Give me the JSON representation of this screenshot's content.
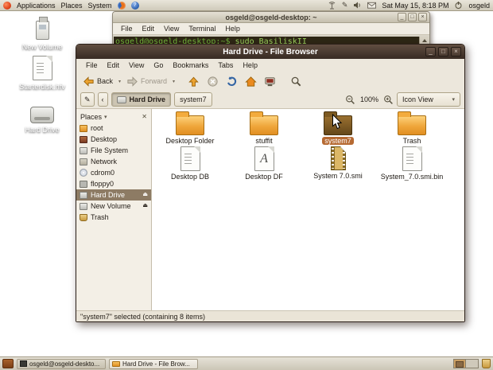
{
  "top_panel": {
    "menus": [
      "Applications",
      "Places",
      "System"
    ],
    "clock": "Sat May 15, 8:18 PM",
    "user": "osgeld"
  },
  "desktop_icons": [
    {
      "label": "New Volume"
    },
    {
      "label": "Starterdisk.hfv"
    },
    {
      "label": "Hard Drive"
    }
  ],
  "terminal": {
    "title": "osgeld@osgeld-desktop: ~",
    "menu": [
      "File",
      "Edit",
      "View",
      "Terminal",
      "Help"
    ],
    "prompt": "osgeld@osgeld-desktop:~$",
    "command": "sudo BasiliskII"
  },
  "file_browser": {
    "title": "Hard Drive - File Browser",
    "menu": [
      "File",
      "Edit",
      "View",
      "Go",
      "Bookmarks",
      "Tabs",
      "Help"
    ],
    "toolbar": {
      "back": "Back",
      "forward": "Forward"
    },
    "location_bar": {
      "breadcrumbs": [
        "Hard Drive",
        "system7"
      ],
      "zoom_level": "100%",
      "view_mode": "Icon View"
    },
    "sidebar": {
      "header": "Places",
      "items": [
        {
          "label": "root"
        },
        {
          "label": "Desktop"
        },
        {
          "label": "File System"
        },
        {
          "label": "Network"
        },
        {
          "label": "cdrom0"
        },
        {
          "label": "floppy0"
        },
        {
          "label": "Hard Drive"
        },
        {
          "label": "New Volume"
        },
        {
          "label": "Trash"
        }
      ]
    },
    "files": [
      {
        "name": "Desktop Folder"
      },
      {
        "name": "stuffit"
      },
      {
        "name": "system7"
      },
      {
        "name": "Trash"
      },
      {
        "name": "Desktop DB"
      },
      {
        "name": "Desktop DF"
      },
      {
        "name": "System 7.0.smi"
      },
      {
        "name": "System_7.0.smi.bin"
      }
    ],
    "status": "\"system7\" selected (containing 8 items)"
  },
  "taskbar": {
    "tasks": [
      {
        "label": "osgeld@osgeld-deskto..."
      },
      {
        "label": "Hard Drive - File Brow..."
      }
    ]
  },
  "glyphs": {
    "pencil": "✎",
    "eject": "⏏",
    "chevron_down": "▾",
    "chevron_left": "‹",
    "minimize": "_",
    "maximize": "□",
    "close": "×",
    "help": "?",
    "doc_a": "A",
    "places_close": "✕"
  },
  "colors": {
    "titlebar_active": "#41332a",
    "desktop_orange": "#e59a24",
    "selection_orange": "#b66a33",
    "sidebar_selection": "#8d7b64",
    "terminal_green": "#72b33c"
  }
}
